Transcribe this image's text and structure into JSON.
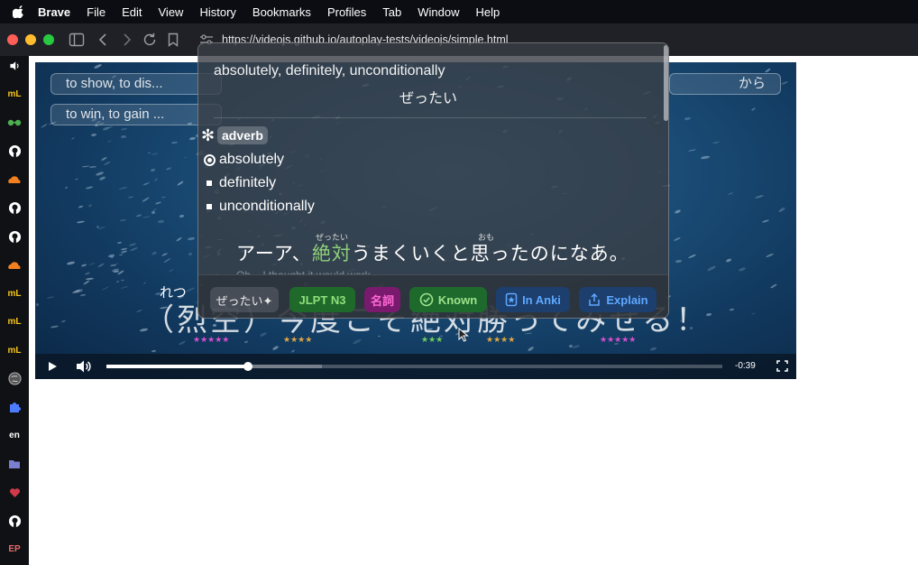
{
  "menubar": {
    "apple_icon": "apple-icon",
    "items": [
      "Brave",
      "File",
      "Edit",
      "View",
      "History",
      "Bookmarks",
      "Profiles",
      "Tab",
      "Window",
      "Help"
    ]
  },
  "browser": {
    "url": "https://videojs.github.io/autoplay-tests/videojs/simple.html"
  },
  "sidebar": {
    "items": [
      {
        "icon": "speaker-icon",
        "text": "🔊"
      },
      {
        "icon": "ml-icon",
        "text": "mL"
      },
      {
        "icon": "glasses-icon",
        "text": "👓"
      },
      {
        "icon": "github-icon",
        "text": ""
      },
      {
        "icon": "cloudflare-icon",
        "text": ""
      },
      {
        "icon": "github-icon",
        "text": ""
      },
      {
        "icon": "github-icon",
        "text": ""
      },
      {
        "icon": "cloudflare-icon",
        "text": ""
      },
      {
        "icon": "ml-icon",
        "text": "mL"
      },
      {
        "icon": "ml-icon",
        "text": "mL"
      },
      {
        "icon": "ml-icon",
        "text": "mL"
      },
      {
        "icon": "globe-icon",
        "text": ""
      },
      {
        "icon": "puzzle-icon",
        "text": ""
      },
      {
        "icon": "en-icon",
        "text": "en"
      },
      {
        "icon": "folder-icon",
        "text": ""
      },
      {
        "icon": "heart-icon",
        "text": ""
      },
      {
        "icon": "github-icon",
        "text": ""
      },
      {
        "icon": "ep-icon",
        "text": "EP"
      }
    ]
  },
  "video": {
    "chips": [
      {
        "text": "to show, to dis..."
      },
      {
        "text": "to win, to gain ..."
      },
      {
        "text": "から"
      }
    ],
    "big_subtitle": "（烈空）今度こそ絶対勝ってみせる！",
    "big_ruby": "れつ",
    "star_groups": [
      "★★★★★",
      "★★★★",
      "★★★",
      "★★★★",
      "★★★★★"
    ],
    "time": "-0:39",
    "progress": 0.23,
    "loaded": 0.35
  },
  "popup": {
    "header": "absolutely, definitely, unconditionally",
    "reading": "ぜったい",
    "pos_badge": "adverb",
    "definitions": [
      "absolutely",
      "definitely",
      "unconditionally"
    ],
    "example": {
      "before": "アーア、",
      "highlight": "絶対",
      "after": "うまくいくと思ったのになあ。",
      "ruby_1": "ぜったい",
      "ruby_2": "おも",
      "translation": "Oh... I thought it would work."
    },
    "buttons": {
      "reading": "ぜったい✦",
      "jlpt": "JLPT N3",
      "noun": "名詞",
      "known": "Known",
      "anki": "In Anki",
      "explain": "Explain"
    }
  },
  "colors": {
    "jlpt": "#8de07a",
    "noun": "#ff6ad5",
    "anki": "#5fa8ff"
  }
}
